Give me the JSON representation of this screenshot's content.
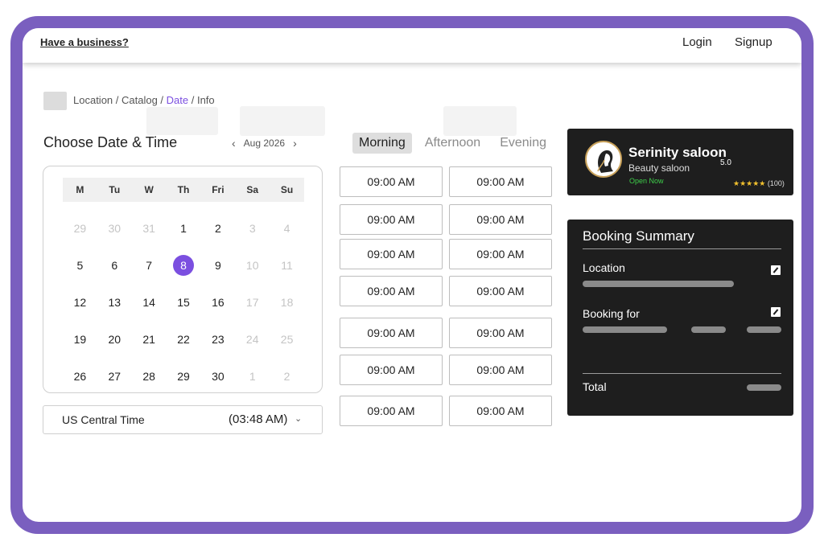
{
  "header": {
    "have_business": "Have a business?",
    "login": "Login",
    "signup": "Signup"
  },
  "breadcrumb": {
    "location": "Location",
    "sep1": " / ",
    "catalog": "Catalog",
    "sep2": " / ",
    "date": "Date",
    "sep3": " / ",
    "info": "Info"
  },
  "date_section": {
    "title": "Choose Date & Time",
    "month": "Aug 2026",
    "weekdays": [
      "M",
      "Tu",
      "W",
      "Th",
      "Fri",
      "Sa",
      "Su"
    ],
    "days": [
      {
        "d": "29",
        "muted": true
      },
      {
        "d": "30",
        "muted": true
      },
      {
        "d": "31",
        "muted": true
      },
      {
        "d": "1"
      },
      {
        "d": "2"
      },
      {
        "d": "3",
        "muted": true
      },
      {
        "d": "4",
        "muted": true
      },
      {
        "d": "5"
      },
      {
        "d": "6"
      },
      {
        "d": "7"
      },
      {
        "d": "8",
        "selected": true
      },
      {
        "d": "9"
      },
      {
        "d": "10",
        "muted": true
      },
      {
        "d": "11",
        "muted": true
      },
      {
        "d": "12"
      },
      {
        "d": "13"
      },
      {
        "d": "14"
      },
      {
        "d": "15"
      },
      {
        "d": "16"
      },
      {
        "d": "17",
        "muted": true
      },
      {
        "d": "18",
        "muted": true
      },
      {
        "d": "19"
      },
      {
        "d": "20"
      },
      {
        "d": "21"
      },
      {
        "d": "22"
      },
      {
        "d": "23"
      },
      {
        "d": "24",
        "muted": true
      },
      {
        "d": "25",
        "muted": true
      },
      {
        "d": "26"
      },
      {
        "d": "27"
      },
      {
        "d": "28"
      },
      {
        "d": "29"
      },
      {
        "d": "30"
      },
      {
        "d": "1",
        "muted": true
      },
      {
        "d": "2",
        "muted": true
      }
    ],
    "timezone": "US Central Time",
    "current_time": "(03:48 AM)"
  },
  "time_section": {
    "tabs": [
      "Morning",
      "Afternoon",
      "Evening"
    ],
    "active_tab": 0,
    "slots": [
      "09:00 AM",
      "09:00 AM",
      "09:00 AM",
      "09:00 AM",
      "09:00 AM",
      "09:00 AM",
      "09:00 AM",
      "09:00 AM",
      "09:00 AM",
      "09:00 AM",
      "09:00 AM",
      "09:00 AM",
      "09:00 AM",
      "09:00 AM"
    ]
  },
  "salon": {
    "name": "Serinity saloon",
    "type": "Beauty saloon",
    "status": "Open Now",
    "score": "5.0",
    "stars": "★★★★★",
    "reviews": "(100)"
  },
  "summary": {
    "title": "Booking Summary",
    "location_label": "Location",
    "booking_for_label": "Booking for",
    "total_label": "Total"
  },
  "colors": {
    "accent": "#7b4fe0",
    "frame": "#7a5fbf",
    "card_bg": "#1e1e1e",
    "open_green": "#3ecf4a",
    "star": "#f2c12e"
  }
}
